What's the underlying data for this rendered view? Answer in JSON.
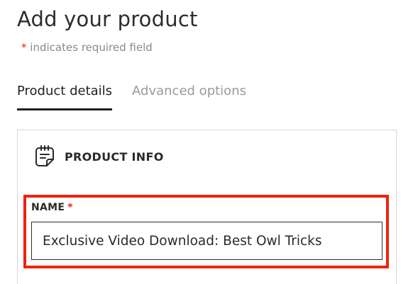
{
  "page": {
    "title": "Add your product",
    "required_star": "*",
    "required_note": "indicates required field"
  },
  "tabs": [
    {
      "label": "Product details",
      "active": true
    },
    {
      "label": "Advanced options",
      "active": false
    }
  ],
  "panel": {
    "icon": "notepad-icon",
    "title": "PRODUCT INFO"
  },
  "name_field": {
    "label": "NAME",
    "required_star": "*",
    "value": "Exclusive Video Download: Best Owl Tricks"
  },
  "colors": {
    "required": "#e0271a",
    "highlight": "#f0210f",
    "text": "#2b2b2b",
    "muted": "#9a9a9a"
  }
}
